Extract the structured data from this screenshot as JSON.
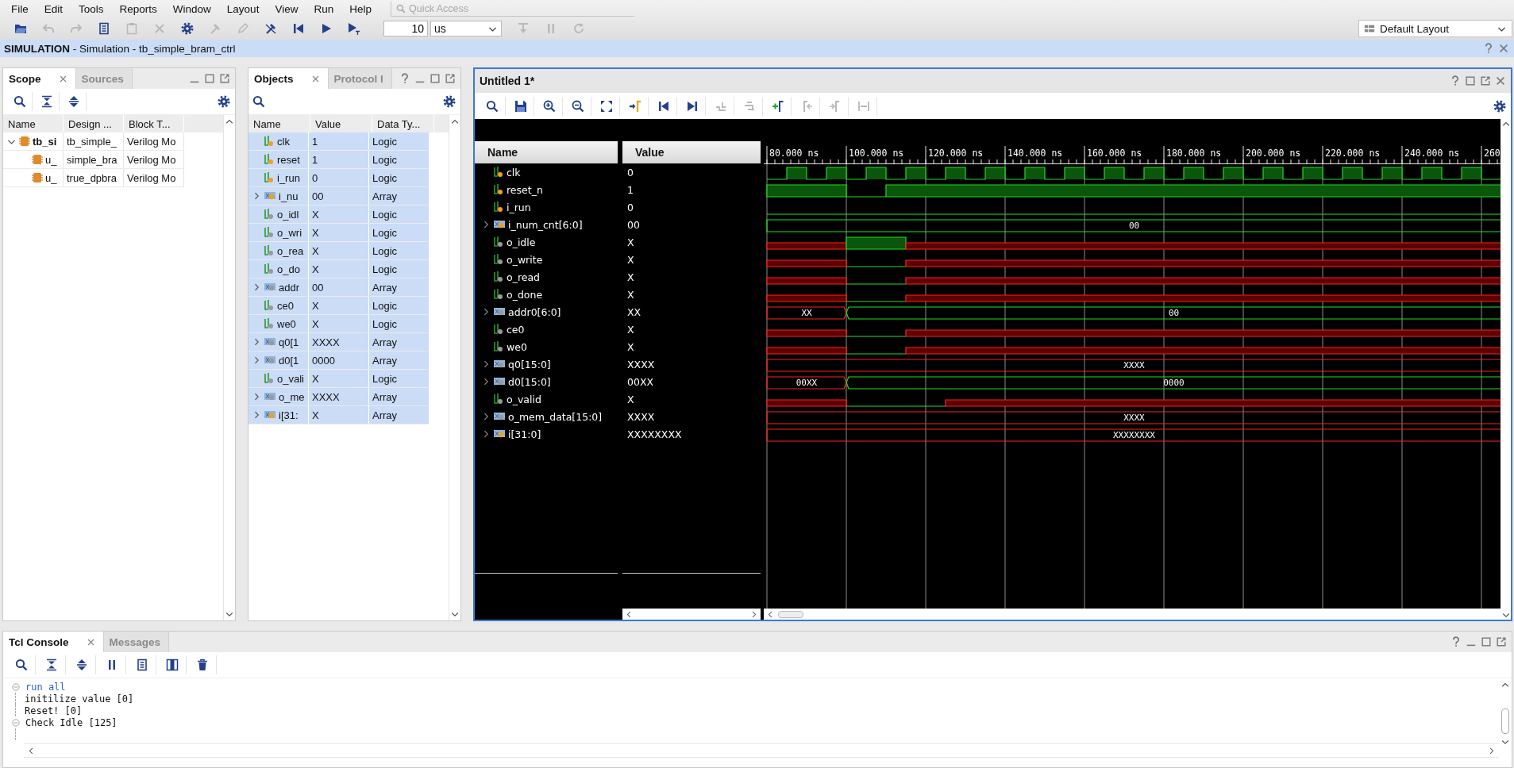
{
  "menu": [
    "File",
    "Edit",
    "Tools",
    "Reports",
    "Window",
    "Layout",
    "View",
    "Run",
    "Help"
  ],
  "quick_access": {
    "placeholder": "Quick Access"
  },
  "toolbar": {
    "left": [
      {
        "kind": "folder",
        "disabled": false
      },
      {
        "kind": "undo",
        "disabled": true
      },
      {
        "kind": "redo",
        "disabled": true
      },
      {
        "kind": "copy",
        "disabled": false
      },
      {
        "kind": "paste",
        "disabled": true
      },
      {
        "kind": "delete",
        "disabled": true
      },
      {
        "kind": "gear",
        "disabled": false
      },
      {
        "kind": "hammer",
        "disabled": true
      },
      {
        "kind": "pen",
        "disabled": true
      },
      {
        "kind": "probe",
        "disabled": false
      },
      {
        "kind": "start",
        "disabled": false
      },
      {
        "kind": "play",
        "disabled": false
      },
      {
        "kind": "playtime",
        "disabled": false
      }
    ],
    "run_time": {
      "value": "10"
    },
    "unit": {
      "value": "us"
    },
    "right": [
      {
        "kind": "stepover",
        "disabled": true
      },
      {
        "kind": "pause",
        "disabled": true
      },
      {
        "kind": "reload",
        "disabled": true
      }
    ]
  },
  "layout_select": {
    "value": "Default Layout"
  },
  "simulation_bar": {
    "title": "**SIMULATION** - Simulation - tb_simple_bram_ctrl"
  },
  "scope_panel": {
    "tabs": [
      {
        "label": "Scope",
        "selected": true,
        "closable": true
      },
      {
        "label": "Sources",
        "selected": false,
        "closable": false
      }
    ],
    "toolbar": [
      {
        "kind": "search",
        "disabled": false
      },
      {
        "kind": "collapse",
        "disabled": false
      },
      {
        "kind": "expand",
        "disabled": false
      }
    ],
    "columns": [
      "Name",
      "Design ...",
      "Block T..."
    ],
    "rows": [
      {
        "cells": [
          "tb_si",
          "tb_simple_",
          "Verilog Mo"
        ],
        "bold": true,
        "expanded": true,
        "children": [
          {
            "cells": [
              "u_",
              "simple_bra",
              "Verilog Mo"
            ],
            "bold": false
          },
          {
            "cells": [
              "u_",
              "true_dpbra",
              "Verilog Mo"
            ],
            "bold": false
          }
        ]
      }
    ]
  },
  "objects_panel": {
    "tabs": [
      {
        "label": "Objects",
        "selected": true,
        "closable": true
      },
      {
        "label": "Protocol I",
        "selected": false,
        "closable": false
      }
    ],
    "columns": [
      "Name",
      "Value",
      "Data Ty..."
    ],
    "rows": [
      {
        "name": "clk",
        "value": "1",
        "type": "Logic",
        "kind": "logic",
        "input": true,
        "selected": true
      },
      {
        "name": "reset",
        "value": "1",
        "type": "Logic",
        "kind": "logic",
        "input": true,
        "selected": true
      },
      {
        "name": "i_run",
        "value": "0",
        "type": "Logic",
        "kind": "logic",
        "input": true,
        "selected": true
      },
      {
        "name": "i_nu",
        "value": "00",
        "type": "Array",
        "kind": "array",
        "input": true,
        "selected": true
      },
      {
        "name": "o_idl",
        "value": "X",
        "type": "Logic",
        "kind": "logic",
        "input": false,
        "selected": true
      },
      {
        "name": "o_wri",
        "value": "X",
        "type": "Logic",
        "kind": "logic",
        "input": false,
        "selected": true
      },
      {
        "name": "o_rea",
        "value": "X",
        "type": "Logic",
        "kind": "logic",
        "input": false,
        "selected": true
      },
      {
        "name": "o_do",
        "value": "X",
        "type": "Logic",
        "kind": "logic",
        "input": false,
        "selected": true
      },
      {
        "name": "addr",
        "value": "00",
        "type": "Array",
        "kind": "array",
        "input": false,
        "selected": true
      },
      {
        "name": "ce0",
        "value": "X",
        "type": "Logic",
        "kind": "logic",
        "input": false,
        "selected": true
      },
      {
        "name": "we0",
        "value": "X",
        "type": "Logic",
        "kind": "logic",
        "input": false,
        "selected": true
      },
      {
        "name": "q0[1",
        "value": "XXXX",
        "type": "Array",
        "kind": "array",
        "input": false,
        "selected": true
      },
      {
        "name": "d0[1",
        "value": "0000",
        "type": "Array",
        "kind": "array",
        "input": false,
        "selected": true
      },
      {
        "name": "o_vali",
        "value": "X",
        "type": "Logic",
        "kind": "logic",
        "input": false,
        "selected": true
      },
      {
        "name": "o_me",
        "value": "XXXX",
        "type": "Array",
        "kind": "array",
        "input": false,
        "selected": true
      },
      {
        "name": "i[31:",
        "value": "X",
        "type": "Array",
        "kind": "array",
        "input": true,
        "selected": true
      }
    ]
  },
  "wave_window": {
    "title": "Untitled 1*",
    "toolbar": [
      {
        "kind": "search",
        "disabled": false
      },
      {
        "kind": "save",
        "disabled": false
      },
      {
        "kind": "zoomin",
        "disabled": false
      },
      {
        "kind": "zoomout",
        "disabled": false
      },
      {
        "kind": "fit",
        "disabled": false
      },
      {
        "kind": "cursor",
        "disabled": false
      },
      {
        "kind": "start",
        "disabled": false
      },
      {
        "kind": "goend",
        "disabled": false
      },
      {
        "kind": "swapup",
        "disabled": true
      },
      {
        "kind": "swapdown",
        "disabled": true
      },
      {
        "kind": "addmarker",
        "disabled": false
      },
      {
        "kind": "prevmarker",
        "disabled": true
      },
      {
        "kind": "nextmarker",
        "disabled": true
      },
      {
        "kind": "spacer",
        "disabled": true
      }
    ],
    "columns": [
      "Name",
      "Value"
    ],
    "time_ticks": [
      "80.000 ns",
      "100.000 ns",
      "120.000 ns",
      "140.000 ns",
      "160.000 ns",
      "180.000 ns",
      "200.000 ns",
      "220.000 ns",
      "240.000 ns",
      "260"
    ],
    "signals": [
      {
        "name": "clk",
        "value": "0",
        "kind": "logic",
        "input": true
      },
      {
        "name": "reset_n",
        "value": "1",
        "kind": "logic",
        "input": true
      },
      {
        "name": "i_run",
        "value": "0",
        "kind": "logic",
        "input": true
      },
      {
        "name": "i_num_cnt[6:0]",
        "value": "00",
        "kind": "array",
        "input": true,
        "bus_labels": [
          "00"
        ]
      },
      {
        "name": "o_idle",
        "value": "X",
        "kind": "logic",
        "input": false
      },
      {
        "name": "o_write",
        "value": "X",
        "kind": "logic",
        "input": false
      },
      {
        "name": "o_read",
        "value": "X",
        "kind": "logic",
        "input": false
      },
      {
        "name": "o_done",
        "value": "X",
        "kind": "logic",
        "input": false
      },
      {
        "name": "addr0[6:0]",
        "value": "XX",
        "kind": "array",
        "input": false,
        "bus_labels": [
          "XX",
          "00"
        ]
      },
      {
        "name": "ce0",
        "value": "X",
        "kind": "logic",
        "input": false
      },
      {
        "name": "we0",
        "value": "X",
        "kind": "logic",
        "input": false
      },
      {
        "name": "q0[15:0]",
        "value": "XXXX",
        "kind": "array",
        "input": false,
        "bus_labels": [
          "XXXX"
        ]
      },
      {
        "name": "d0[15:0]",
        "value": "00XX",
        "kind": "array",
        "input": false,
        "bus_labels": [
          "00XX",
          "0000"
        ]
      },
      {
        "name": "o_valid",
        "value": "X",
        "kind": "logic",
        "input": false
      },
      {
        "name": "o_mem_data[15:0]",
        "value": "XXXX",
        "kind": "array",
        "input": false,
        "bus_labels": [
          "XXXX"
        ]
      },
      {
        "name": "i[31:0]",
        "value": "XXXXXXXX",
        "kind": "array",
        "input": true,
        "bus_labels": [
          "XXXXXXXX"
        ]
      }
    ]
  },
  "console": {
    "tabs": [
      {
        "label": "Tcl Console",
        "selected": true,
        "closable": true
      },
      {
        "label": "Messages",
        "selected": false,
        "closable": false
      }
    ],
    "toolbar": [
      {
        "kind": "search",
        "disabled": false
      },
      {
        "kind": "collapse",
        "disabled": false
      },
      {
        "kind": "expand",
        "disabled": false
      },
      {
        "kind": "pause",
        "disabled": false
      },
      {
        "kind": "copy",
        "disabled": false
      },
      {
        "kind": "columns",
        "disabled": false
      },
      {
        "kind": "trash",
        "disabled": false
      }
    ],
    "lines": [
      {
        "text": "run all",
        "kind": "command",
        "fold_marker": true
      },
      {
        "text": "initilize value [0]",
        "kind": "output",
        "fold_marker": false
      },
      {
        "text": "Reset! [0]",
        "kind": "output",
        "fold_marker": false
      },
      {
        "text": "Check Idle [125]",
        "kind": "output",
        "fold_marker": true
      }
    ]
  }
}
